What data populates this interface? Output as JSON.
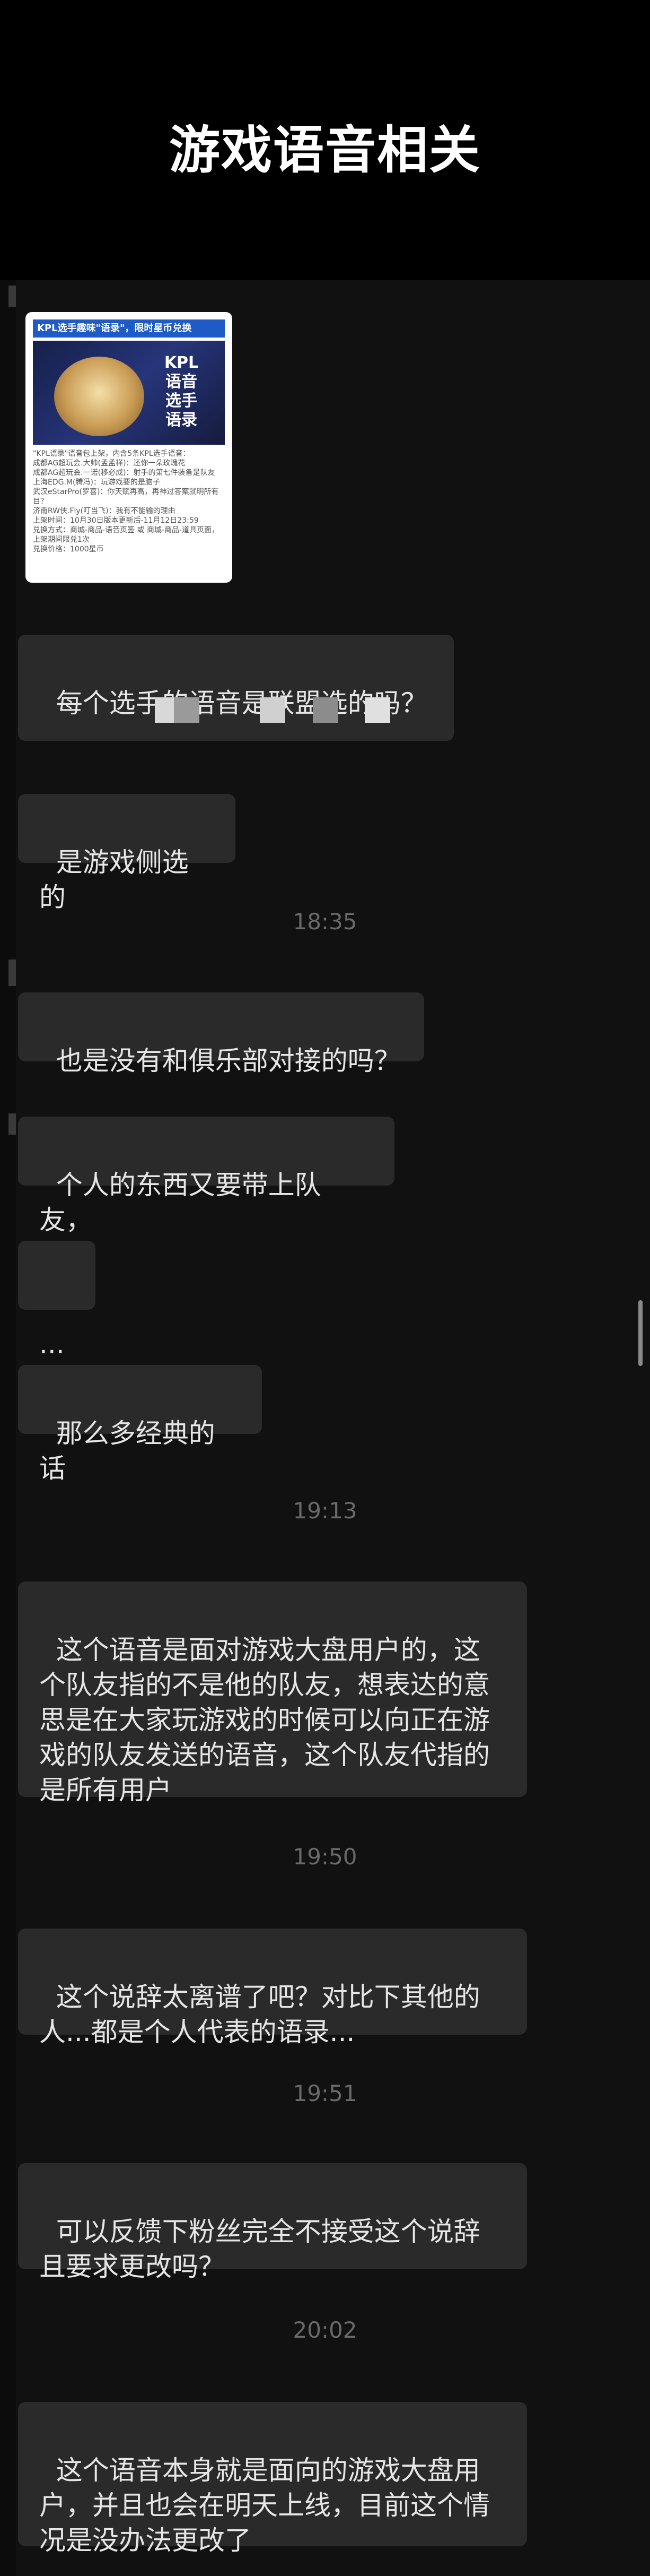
{
  "header": {
    "title": "游戏语音相关"
  },
  "card": {
    "banner": "KPL选手趣味\"语录\"，限时星币兑换",
    "poster_text": "KPL语音\n选手\n语录",
    "body": "\"KPL语录\"语音包上架，内含5条KPL选手语音：\n成都AG超玩会.大帅(孟孟祥)：还你一朵玫瑰花\n成都AG超玩会.一诺(移必成)：射手的第七件装备是队友\n上海EDG.M(腾冯)：玩游戏要的是脑子\n武汉eStarPro(罗喜)：你天赋再高，再神过答案就明所有目？\n济南RW侠.Fly(叮当飞)：我有不能输的理由\n上架时间：10月30日版本更新后-11月12日23:59\n兑换方式：商城-商品-语音页签 或 商城-商品-道具页面，上架期间限兑1次\n兑换价格：1000星币"
  },
  "messages": [
    {
      "type": "bubble",
      "text": "每个选手的语音是联盟选的吗？"
    },
    {
      "type": "bubble",
      "text": "是游戏侧选的"
    },
    {
      "type": "time",
      "text": "18:35"
    },
    {
      "type": "bubble",
      "text": "也是没有和俱乐部对接的吗？"
    },
    {
      "type": "bubble",
      "text": "个人的东西又要带上队友，"
    },
    {
      "type": "bubble",
      "text": "..."
    },
    {
      "type": "bubble",
      "text": "那么多经典的话"
    },
    {
      "type": "time",
      "text": "19:13"
    },
    {
      "type": "bubble",
      "text": "这个语音是面对游戏大盘用户的，这个队友指的不是他的队友，想表达的意思是在大家玩游戏的时候可以向正在游戏的队友发送的语音，这个队友代指的是所有用户"
    },
    {
      "type": "time",
      "text": "19:50"
    },
    {
      "type": "bubble",
      "text": "这个说辞太离谱了吧？对比下其他的人...都是个人代表的语录..."
    },
    {
      "type": "time",
      "text": "19:51"
    },
    {
      "type": "bubble",
      "text": "可以反馈下粉丝完全不接受这个说辞且要求更改吗？"
    },
    {
      "type": "time",
      "text": "20:02"
    },
    {
      "type": "bubble",
      "text": "这个语音本身就是面向的游戏大盘用户，并且也会在明天上线，目前这个情况是没办法更改了"
    }
  ]
}
